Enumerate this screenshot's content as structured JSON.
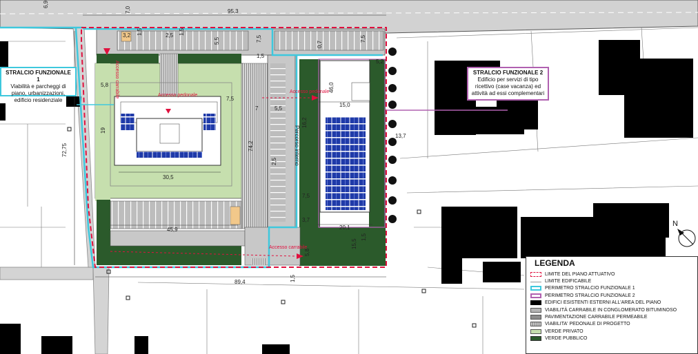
{
  "stralcio1": {
    "title": "STRALCIO FUNZIONALE 1",
    "desc": "Viabilità e parcheggi di piano, urbanizzazioni, edificio residenziale"
  },
  "stralcio2": {
    "title": "STRALCIO FUNZIONALE 2",
    "desc": "Edificio per servizi di tipo ricettivo (case vacanza) ed attività ad essi complementari"
  },
  "labels": {
    "accesso_carrabile": "Accesso carrabile",
    "accesso_pedonale": "Accesso pedonale",
    "percorso_interno": "Percorso interno",
    "north": "N"
  },
  "dimensions": {
    "d69": "6,9",
    "d70": "7,0",
    "d953": "95,3",
    "d32": "3,2",
    "d15a": "1,5",
    "d25": "2,5",
    "d15b": "1,5",
    "d55": "5,5",
    "d75a": "7,5",
    "d07": "0,7",
    "d75b": "7,5",
    "d15c": "1,5",
    "d52": "5,2",
    "d58a": "5,8",
    "d75c": "7,5",
    "d7": "7",
    "d55b": "5,5",
    "d46": "46,0",
    "d150": "15,0",
    "d19": "19",
    "d7275": "72,75",
    "d742": "74,2",
    "d25b": "2,5",
    "d162": "16,2",
    "d137": "13,7",
    "d305": "30,5",
    "d75d": "7,5",
    "d37": "3,7",
    "d201": "20,1",
    "d459": "45,9",
    "d155": "15,5",
    "d15d": "1,5",
    "d58b": "5,8",
    "d894": "89,4",
    "d15e": "1,5"
  },
  "legend": {
    "title": "LEGENDA",
    "items": [
      {
        "label": "LIMITE DEL PIANO ATTUATIVO",
        "swatch": "sw-dash"
      },
      {
        "label": "LIMITE EDIFICABILE",
        "swatch": "sw-grayline"
      },
      {
        "label": "PERIMETRO STRALCIO FUNZIONALE 1",
        "swatch": "sw-cyan"
      },
      {
        "label": "PERIMETRO STRALCIO FUNZIONALE 2",
        "swatch": "sw-purple"
      },
      {
        "label": "EDIFICI ESISTENTI ESTERNI ALL'AREA DEL PIANO",
        "swatch": "sw-black"
      },
      {
        "label": "VIABILITÀ CARRABILE IN CONGLOMERATO BITUMINOSO",
        "swatch": "sw-gray"
      },
      {
        "label": "PAVIMENTAZIONE CARRABILE PERMEABILE",
        "swatch": "sw-gray2"
      },
      {
        "label": "VIABILITA' PEDONALE DI PROGETTO",
        "swatch": "sw-ped"
      },
      {
        "label": "VERDE PRIVATO",
        "swatch": "sw-lgreen"
      },
      {
        "label": "VERDE PUBBLICO",
        "swatch": "sw-dgreen"
      }
    ]
  },
  "colors": {
    "plan_limit": "#e0103e",
    "stralcio1": "#3ec8dd",
    "stralcio2": "#b060b0",
    "private_green": "#c6dfae",
    "public_green": "#2b5a2b",
    "road": "#c8c8c8",
    "buildings": "#000000",
    "solar": "#1f3aa8"
  }
}
